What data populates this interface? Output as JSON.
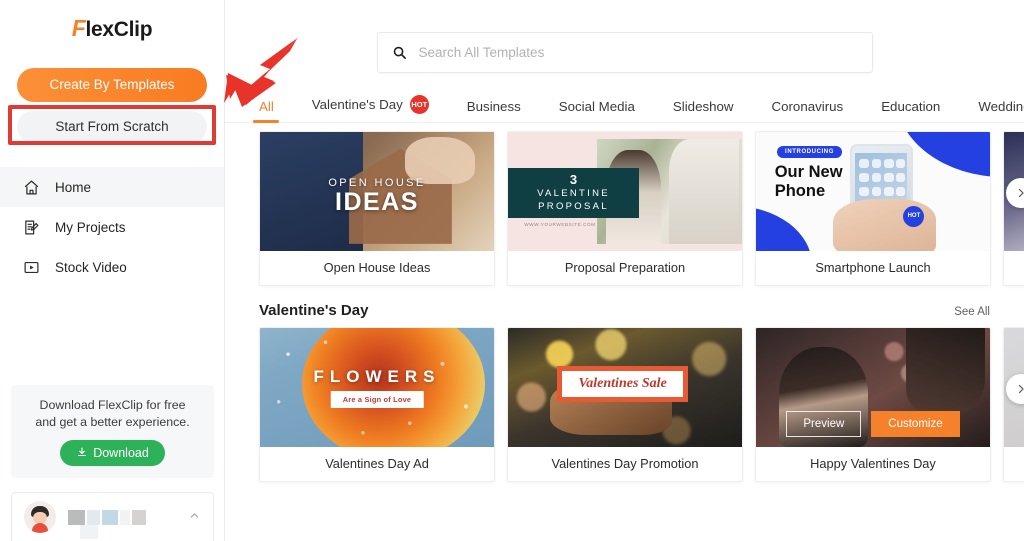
{
  "sidebar": {
    "logo": {
      "mark": "F",
      "rest": "lexClip",
      "full": "FlexClip"
    },
    "create_templates_label": "Create By Templates",
    "start_scratch_label": "Start From Scratch",
    "nav": [
      {
        "label": "Home",
        "icon": "home-icon",
        "active": true
      },
      {
        "label": "My Projects",
        "icon": "projects-icon",
        "active": false
      },
      {
        "label": "Stock Video",
        "icon": "video-icon",
        "active": false
      }
    ],
    "promo": {
      "line1": "Download FlexClip for free",
      "line2": "and get a better experience.",
      "button_label": "Download",
      "button_color": "#2db25a"
    },
    "user": {
      "avatar": "user-avatar",
      "chevron": "chevron-up-icon"
    }
  },
  "search": {
    "placeholder": "Search All Templates",
    "value": "",
    "icon": "search-icon"
  },
  "tabs": [
    {
      "label": "All",
      "active": true,
      "badge": ""
    },
    {
      "label": "Valentine's Day",
      "active": false,
      "badge": "HOT"
    },
    {
      "label": "Business",
      "active": false,
      "badge": ""
    },
    {
      "label": "Social Media",
      "active": false,
      "badge": ""
    },
    {
      "label": "Slideshow",
      "active": false,
      "badge": ""
    },
    {
      "label": "Coronavirus",
      "active": false,
      "badge": ""
    },
    {
      "label": "Education",
      "active": false,
      "badge": ""
    },
    {
      "label": "Wedding",
      "active": false,
      "badge": ""
    }
  ],
  "sections": [
    {
      "title": "",
      "see_all": "",
      "cards": [
        {
          "caption": "Open House Ideas",
          "art": "openhouse",
          "overlay_lines": [
            "OPEN HOUSE",
            "IDEAS"
          ]
        },
        {
          "caption": "Proposal Preparation",
          "art": "proposal",
          "overlay_lines": [
            "3",
            "VALENTINE",
            "PROPOSAL"
          ],
          "url_text": "WWW.YOURWEBSITE.COM"
        },
        {
          "caption": "Smartphone Launch",
          "art": "phone",
          "overlay_lines": [
            "INTRODUCING",
            "Our New",
            "Phone"
          ],
          "badge": "HOT"
        },
        {
          "caption": "",
          "art": "partial1"
        }
      ],
      "next_arrow": "chevron-right-icon"
    },
    {
      "title": "Valentine's Day",
      "see_all": "See All",
      "cards": [
        {
          "caption": "Valentines Day Ad",
          "art": "flowers",
          "overlay_lines": [
            "FLOWERS",
            "Are a Sign of Love"
          ]
        },
        {
          "caption": "Valentines Day Promotion",
          "art": "sale",
          "overlay_lines": [
            "Valentines Sale"
          ]
        },
        {
          "caption": "Happy Valentines Day",
          "art": "happy",
          "hovered": true,
          "preview_label": "Preview",
          "customize_label": "Customize"
        },
        {
          "caption": "",
          "art": "partial2"
        }
      ],
      "next_arrow": "chevron-right-icon"
    }
  ],
  "annotation": {
    "arrow_color": "#e8332a",
    "highlight_color": "#e03a34",
    "target": "Start From Scratch"
  }
}
